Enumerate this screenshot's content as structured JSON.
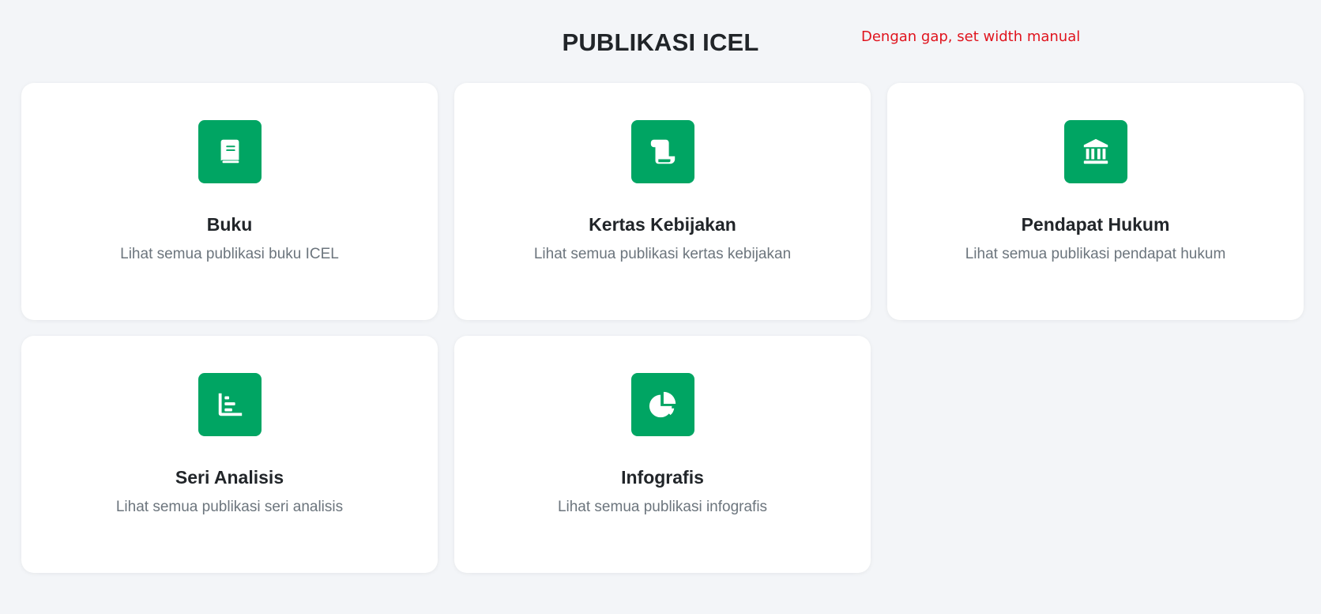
{
  "header": {
    "title": "PUBLIKASI ICEL",
    "annotation": "Dengan gap, set width manual"
  },
  "cards": [
    {
      "icon": "book-icon",
      "title": "Buku",
      "description": "Lihat semua publikasi buku ICEL"
    },
    {
      "icon": "scroll-icon",
      "title": "Kertas Kebijakan",
      "description": "Lihat semua publikasi kertas kebijakan"
    },
    {
      "icon": "landmark-icon",
      "title": "Pendapat Hukum",
      "description": "Lihat semua publikasi pendapat hukum"
    },
    {
      "icon": "bar-chart-icon",
      "title": "Seri Analisis",
      "description": "Lihat semua publikasi seri analisis"
    },
    {
      "icon": "pie-chart-icon",
      "title": "Infografis",
      "description": "Lihat semua publikasi infografis"
    }
  ],
  "colors": {
    "accent": "#00a563",
    "background": "#f3f5f8",
    "annotation": "#e0141e"
  }
}
